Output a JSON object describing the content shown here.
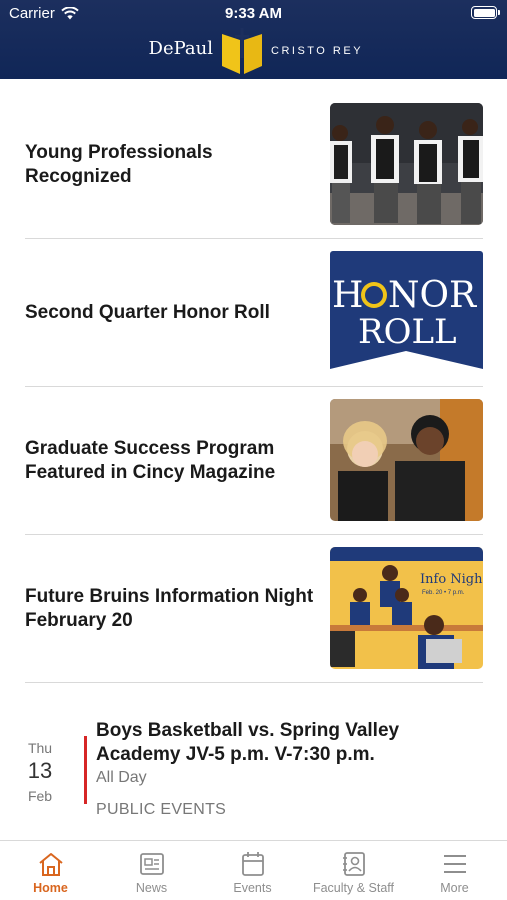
{
  "status_bar": {
    "carrier": "Carrier",
    "time": "9:33 AM"
  },
  "header": {
    "logo_left": "DePaul",
    "logo_right": "CRISTO REY"
  },
  "news": [
    {
      "title": "Young Professionals Recognized",
      "thumb": "group-of-students-photo"
    },
    {
      "title": "Second Quarter Honor Roll",
      "thumb": "honor-roll-banner",
      "thumb_text_1": "H",
      "thumb_text_2": "NOR",
      "thumb_text_3": "ROLL"
    },
    {
      "title": "Graduate Success Program Featured in Cincy Magazine",
      "thumb": "two-women-photo"
    },
    {
      "title": "Future Bruins Information Night February 20",
      "thumb": "info-night-flyer",
      "thumb_text_1": "Info Nigh",
      "thumb_text_2": "Feb. 20 • 7 p.m."
    }
  ],
  "event": {
    "dow": "Thu",
    "day": "13",
    "month": "Feb",
    "title": "Boys Basketball vs. Spring Valley Academy JV-5 p.m. V-7:30 p.m.",
    "time": "All Day",
    "category": "PUBLIC EVENTS"
  },
  "tabs": [
    {
      "label": "Home",
      "icon": "home-icon",
      "active": true
    },
    {
      "label": "News",
      "icon": "news-icon",
      "active": false
    },
    {
      "label": "Events",
      "icon": "calendar-icon",
      "active": false
    },
    {
      "label": "Faculty & Staff",
      "icon": "contact-card-icon",
      "active": false
    },
    {
      "label": "More",
      "icon": "menu-icon",
      "active": false
    }
  ],
  "colors": {
    "header_bg": "#102657",
    "accent": "#d9661f",
    "event_bar": "#d62626",
    "logo_gold": "#f0c419"
  }
}
